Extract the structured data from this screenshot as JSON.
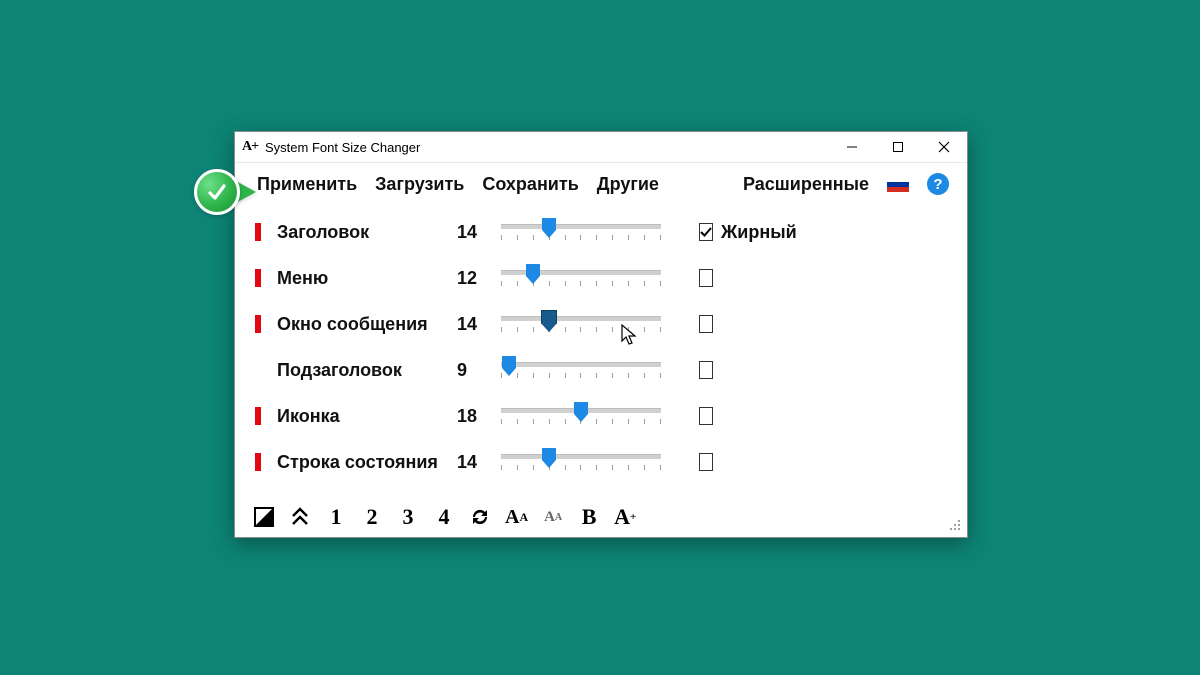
{
  "titlebar": {
    "title": "System Font Size Changer",
    "icon_label": "A+"
  },
  "menu": {
    "apply": "Применить",
    "load": "Загрузить",
    "save": "Сохранить",
    "other": "Другие",
    "advanced": "Расширенные"
  },
  "bold_label": "Жирный",
  "items": [
    {
      "label": "Заголовок",
      "value": "14",
      "pos": 30,
      "marker": true,
      "bold": true,
      "active": false
    },
    {
      "label": "Меню",
      "value": "12",
      "pos": 20,
      "marker": true,
      "bold": false,
      "active": false
    },
    {
      "label": "Окно сообщения",
      "value": "14",
      "pos": 30,
      "marker": true,
      "bold": false,
      "active": true
    },
    {
      "label": "Подзаголовок",
      "value": "9",
      "pos": 5,
      "marker": false,
      "bold": false,
      "active": false
    },
    {
      "label": "Иконка",
      "value": "18",
      "pos": 50,
      "marker": true,
      "bold": false,
      "active": false
    },
    {
      "label": "Строка состояния",
      "value": "14",
      "pos": 30,
      "marker": true,
      "bold": false,
      "active": false
    }
  ],
  "toolbar": {
    "preset1": "1",
    "preset2": "2",
    "preset3": "3",
    "preset4": "4",
    "aa_big": "AA",
    "aa_small": "AA",
    "bold_b": "B",
    "a_plus": "A"
  }
}
